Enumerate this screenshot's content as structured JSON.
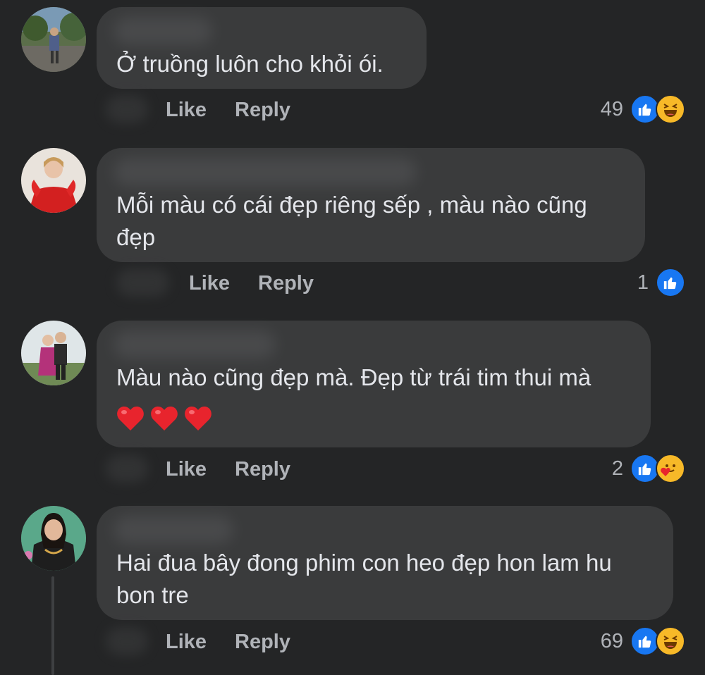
{
  "comments": [
    {
      "text": "Ở truồng luôn cho khỏi ói.",
      "like_label": "Like",
      "reply_label": "Reply",
      "reaction_count": "49",
      "reactions": [
        "like-icon",
        "haha-icon"
      ]
    },
    {
      "text": "Mỗi màu có cái đẹp riêng sếp , màu nào cũng\nđẹp",
      "like_label": "Like",
      "reply_label": "Reply",
      "reaction_count": "1",
      "reactions": [
        "like-icon"
      ]
    },
    {
      "text": "Màu nào cũng đẹp mà. Đẹp từ trái tim thui mà",
      "emoji": "❤️❤️❤️",
      "like_label": "Like",
      "reply_label": "Reply",
      "reaction_count": "2",
      "reactions": [
        "like-icon",
        "care-icon"
      ]
    },
    {
      "text": "Hai đua bây đong phim con heo đẹp hon lam hu\nbon tre",
      "like_label": "Like",
      "reply_label": "Reply",
      "reaction_count": "69",
      "reactions": [
        "like-icon",
        "haha-icon"
      ]
    }
  ],
  "colors": {
    "background": "#242526",
    "bubble": "#3a3b3c",
    "like_blue": "#1877f2",
    "haha_yellow": "#f7b928",
    "action_text": "#b0b3b8"
  }
}
